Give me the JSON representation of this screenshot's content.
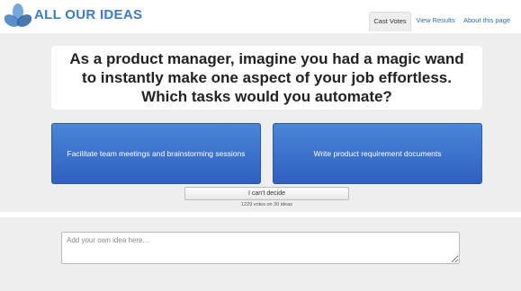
{
  "header": {
    "brand": "ALL OUR IDEAS",
    "tabs": [
      {
        "label": "Cast Votes",
        "active": true
      },
      {
        "label": "View Results",
        "active": false
      },
      {
        "label": "About this page",
        "active": false
      }
    ]
  },
  "question": {
    "text": "As a product manager, imagine you had a magic wand to instantly make one aspect of your job effortless. Which tasks would you automate?"
  },
  "choices": {
    "left": "Facilitate team meetings and brainstorming sessions",
    "right": "Write product requirement documents"
  },
  "cant_decide_label": "I can't decide",
  "vote_count": "1229 votes on 30 ideas",
  "add_idea": {
    "placeholder": "Add your own idea here...",
    "value": ""
  },
  "colors": {
    "brand": "#3d7bbf",
    "choice_button": "#3a6fd0",
    "background": "#eeeeee"
  },
  "icons": {
    "logo": "triangle-petals-logo-icon"
  }
}
